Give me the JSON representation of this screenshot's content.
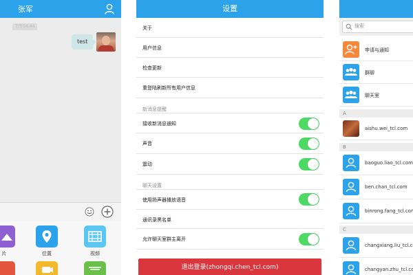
{
  "chat": {
    "title": "张军",
    "timestamp": "下午04:44",
    "message": "test",
    "tray": [
      {
        "label": "片"
      },
      {
        "label": "位置"
      },
      {
        "label": "视频"
      }
    ]
  },
  "settings": {
    "title": "设置",
    "items": [
      {
        "label": "关于"
      },
      {
        "label": "用户信息"
      },
      {
        "label": "检查更新"
      },
      {
        "label": "重登陆刷新所有用户信息"
      }
    ],
    "section_notify": "新消息提醒",
    "notify_items": [
      {
        "label": "接收新消息通知",
        "on": true
      },
      {
        "label": "声音",
        "on": true
      },
      {
        "label": "震动",
        "on": true
      }
    ],
    "section_chat": "聊天设置",
    "chat_items": [
      {
        "label": "使用扬声器播放语音",
        "on": true
      },
      {
        "label": "通讯录黑名单"
      },
      {
        "label": "允许聊天室群主离开",
        "on": true
      }
    ],
    "logout": "退出登录(zhongqi.chen_tcl.com)"
  },
  "contacts": {
    "search_placeholder": "搜索",
    "top_items": [
      {
        "label": "申请与通知",
        "color": "#f5883a"
      },
      {
        "label": "群聊",
        "color": "#2ba2e9"
      },
      {
        "label": "聊天室",
        "color": "#2ba2e9"
      }
    ],
    "sections": [
      {
        "letter": "A",
        "names": [
          "aishu.wei_tcl.com"
        ]
      },
      {
        "letter": "B",
        "names": [
          "baoguo.liao_tcl.com",
          "ben.chan_tcl.com",
          "binrong.fang_tcl.com"
        ]
      },
      {
        "letter": "C",
        "names": [
          "changxiang.liu_tcl.com",
          "changyan.zhu_tcl.com"
        ]
      }
    ]
  },
  "colors": {
    "accent": "#2ba2e9",
    "toggle_on": "#4cd964",
    "logout": "#d9363e",
    "notify": "#f5883a"
  }
}
